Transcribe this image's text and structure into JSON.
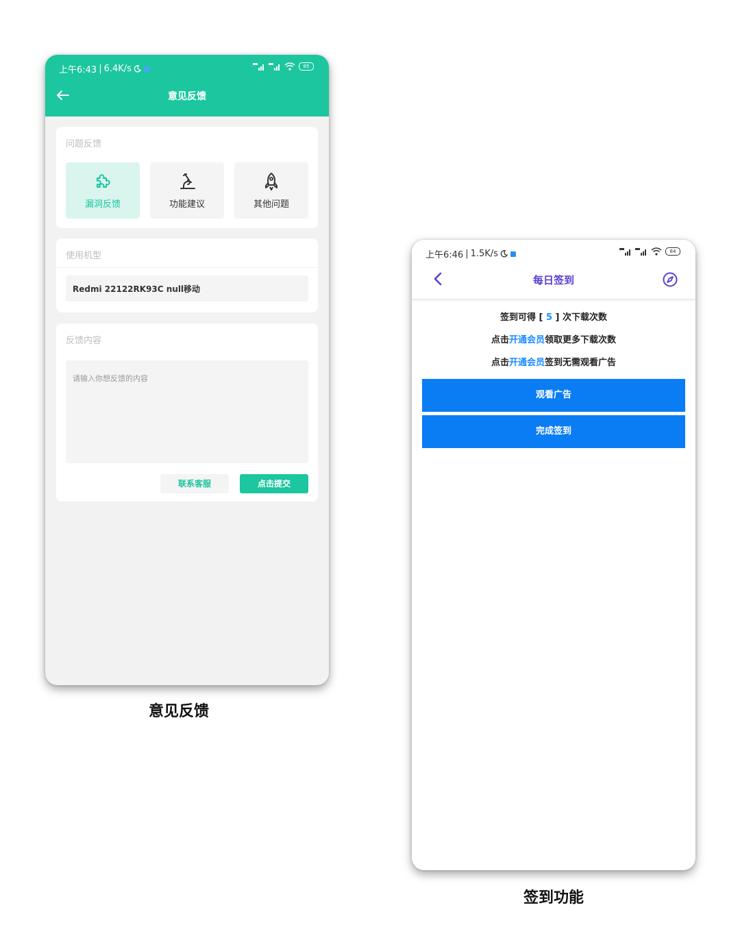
{
  "feedback_screen": {
    "status": {
      "time": "上午6:43",
      "speed": "6.4K/s",
      "battery": "85",
      "accent": "#1cc69f"
    },
    "title": "意见反馈",
    "section_issue": {
      "label": "问题反馈",
      "options": [
        {
          "label": "漏洞反馈",
          "icon": "puzzle-icon",
          "selected": true
        },
        {
          "label": "功能建议",
          "icon": "microscope-icon",
          "selected": false
        },
        {
          "label": "其他问题",
          "icon": "rocket-icon",
          "selected": false
        }
      ]
    },
    "section_model": {
      "label": "使用机型",
      "value": "Redmi 22122RK93C null移动"
    },
    "section_content": {
      "label": "反馈内容",
      "placeholder": "请输入你想反馈的内容"
    },
    "buttons": {
      "contact": "联系客服",
      "submit": "点击提交"
    }
  },
  "checkin_screen": {
    "status": {
      "time": "上午6:46",
      "speed": "1.5K/s",
      "battery": "84"
    },
    "title": "每日签到",
    "info": {
      "line1_prefix": "签到可得 [ ",
      "line1_count": "5",
      "line1_suffix": " ] 次下载次数",
      "line2_prefix": "点击",
      "line2_link": "开通会员",
      "line2_suffix": "领取更多下载次数",
      "line3_prefix": "点击",
      "line3_link": "开通会员",
      "line3_suffix": "签到无需观看广告"
    },
    "buttons": {
      "watch_ad": "观看广告",
      "complete": "完成签到"
    },
    "colors": {
      "title": "#5b3fd1",
      "button": "#0a7df5",
      "link": "#1a8cff"
    }
  },
  "captions": {
    "left": "意见反馈",
    "right": "签到功能"
  }
}
